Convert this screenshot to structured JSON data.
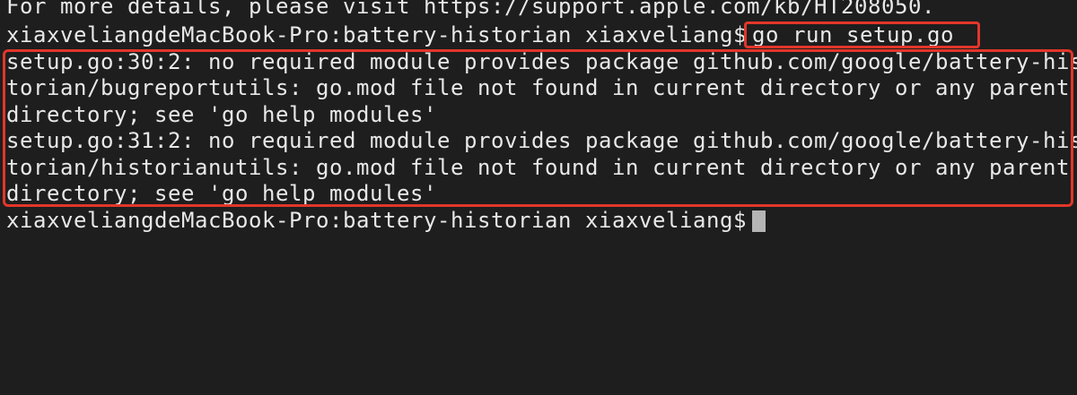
{
  "terminal": {
    "lines": [
      "For more details, please visit https://support.apple.com/kb/HT208050.",
      "xiaxveliangdeMacBook-Pro:battery-historian xiaxveliang$ ",
      "setup.go:30:2: no required module provides package github.com/google/battery-his",
      "torian/bugreportutils: go.mod file not found in current directory or any parent",
      "directory; see 'go help modules'",
      "setup.go:31:2: no required module provides package github.com/google/battery-his",
      "torian/historianutils: go.mod file not found in current directory or any parent",
      "directory; see 'go help modules'",
      "xiaxveliangdeMacBook-Pro:battery-historian xiaxveliang$ "
    ],
    "command": "go run setup.go"
  },
  "colors": {
    "background": "#1e1e1e",
    "text": "#e8e8e8",
    "cursor": "#b5b5b5",
    "highlight": "#e2362a"
  }
}
